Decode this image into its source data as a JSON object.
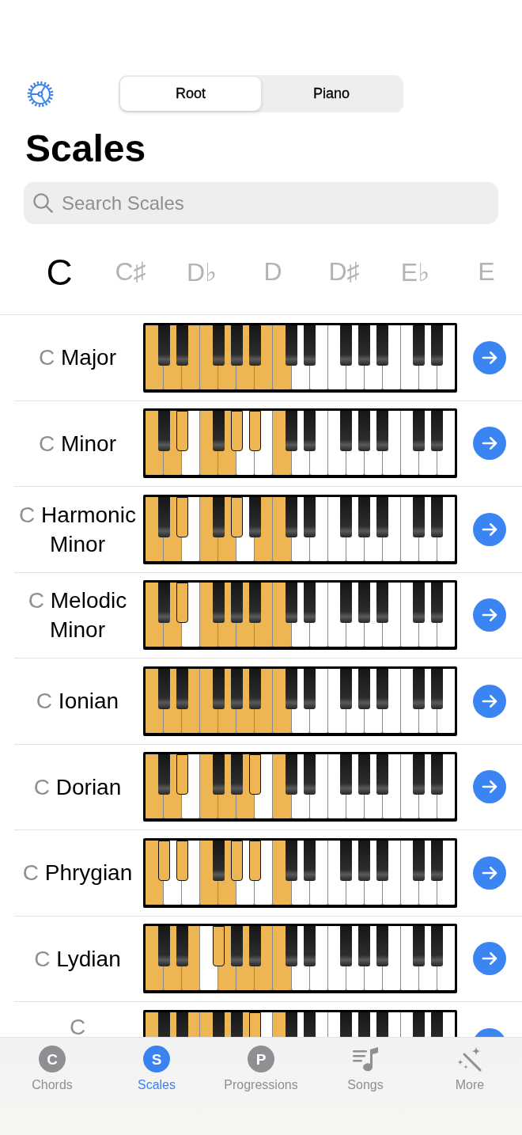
{
  "header": {
    "segments": [
      {
        "label": "Root",
        "selected": true
      },
      {
        "label": "Piano",
        "selected": false
      }
    ]
  },
  "title": "Scales",
  "search": {
    "placeholder": "Search Scales"
  },
  "root_notes": [
    {
      "label": "C",
      "selected": true
    },
    {
      "label": "C♯",
      "selected": false
    },
    {
      "label": "D♭",
      "selected": false
    },
    {
      "label": "D",
      "selected": false
    },
    {
      "label": "D♯",
      "selected": false
    },
    {
      "label": "E♭",
      "selected": false
    },
    {
      "label": "E",
      "selected": false
    }
  ],
  "scales": [
    {
      "root": "C",
      "name": "Major",
      "white_keys": [
        true,
        true,
        true,
        true,
        true,
        true,
        true,
        true,
        false,
        false,
        false,
        false,
        false,
        false,
        false,
        false,
        false
      ],
      "black_keys": [
        false,
        false,
        false,
        false,
        false,
        false,
        false,
        false,
        false,
        false,
        false,
        false
      ]
    },
    {
      "root": "C",
      "name": "Minor",
      "white_keys": [
        true,
        true,
        false,
        true,
        true,
        false,
        false,
        true,
        false,
        false,
        false,
        false,
        false,
        false,
        false,
        false,
        false
      ],
      "black_keys": [
        false,
        true,
        false,
        true,
        true,
        false,
        false,
        false,
        false,
        false,
        false,
        false
      ]
    },
    {
      "root": "C",
      "name": "Harmonic Minor",
      "white_keys": [
        true,
        true,
        false,
        true,
        true,
        false,
        true,
        true,
        false,
        false,
        false,
        false,
        false,
        false,
        false,
        false,
        false
      ],
      "black_keys": [
        false,
        true,
        false,
        true,
        false,
        false,
        false,
        false,
        false,
        false,
        false,
        false
      ]
    },
    {
      "root": "C",
      "name": "Melodic Minor",
      "white_keys": [
        true,
        true,
        false,
        true,
        true,
        true,
        true,
        true,
        false,
        false,
        false,
        false,
        false,
        false,
        false,
        false,
        false
      ],
      "black_keys": [
        false,
        true,
        false,
        false,
        false,
        false,
        false,
        false,
        false,
        false,
        false,
        false
      ]
    },
    {
      "root": "C",
      "name": "Ionian",
      "white_keys": [
        true,
        true,
        true,
        true,
        true,
        true,
        true,
        true,
        false,
        false,
        false,
        false,
        false,
        false,
        false,
        false,
        false
      ],
      "black_keys": [
        false,
        false,
        false,
        false,
        false,
        false,
        false,
        false,
        false,
        false,
        false,
        false
      ]
    },
    {
      "root": "C",
      "name": "Dorian",
      "white_keys": [
        true,
        true,
        false,
        true,
        true,
        true,
        false,
        true,
        false,
        false,
        false,
        false,
        false,
        false,
        false,
        false,
        false
      ],
      "black_keys": [
        false,
        true,
        false,
        false,
        true,
        false,
        false,
        false,
        false,
        false,
        false,
        false
      ]
    },
    {
      "root": "C",
      "name": "Phrygian",
      "white_keys": [
        true,
        false,
        false,
        true,
        true,
        false,
        false,
        true,
        false,
        false,
        false,
        false,
        false,
        false,
        false,
        false,
        false
      ],
      "black_keys": [
        true,
        true,
        false,
        true,
        true,
        false,
        false,
        false,
        false,
        false,
        false,
        false
      ]
    },
    {
      "root": "C",
      "name": "Lydian",
      "white_keys": [
        true,
        true,
        true,
        false,
        true,
        true,
        true,
        true,
        false,
        false,
        false,
        false,
        false,
        false,
        false,
        false,
        false
      ],
      "black_keys": [
        false,
        false,
        true,
        false,
        false,
        false,
        false,
        false,
        false,
        false,
        false,
        false
      ]
    },
    {
      "root": "C",
      "white_keys": [
        true,
        true,
        true,
        true,
        true,
        true,
        false,
        true,
        false,
        false,
        false,
        false,
        false,
        false,
        false,
        false,
        false
      ],
      "black_keys": [
        false,
        false,
        false,
        false,
        true,
        false,
        false,
        false,
        false,
        false,
        false,
        false
      ]
    }
  ],
  "tab_bar": [
    {
      "kind": "letter",
      "icon_letter": "C",
      "label": "Chords",
      "selected": false
    },
    {
      "kind": "letter",
      "icon_letter": "S",
      "label": "Scales",
      "selected": true
    },
    {
      "kind": "letter",
      "icon_letter": "P",
      "label": "Progressions",
      "selected": false
    },
    {
      "kind": "songs",
      "label": "Songs",
      "selected": false
    },
    {
      "kind": "more",
      "label": "More",
      "selected": false
    }
  ]
}
